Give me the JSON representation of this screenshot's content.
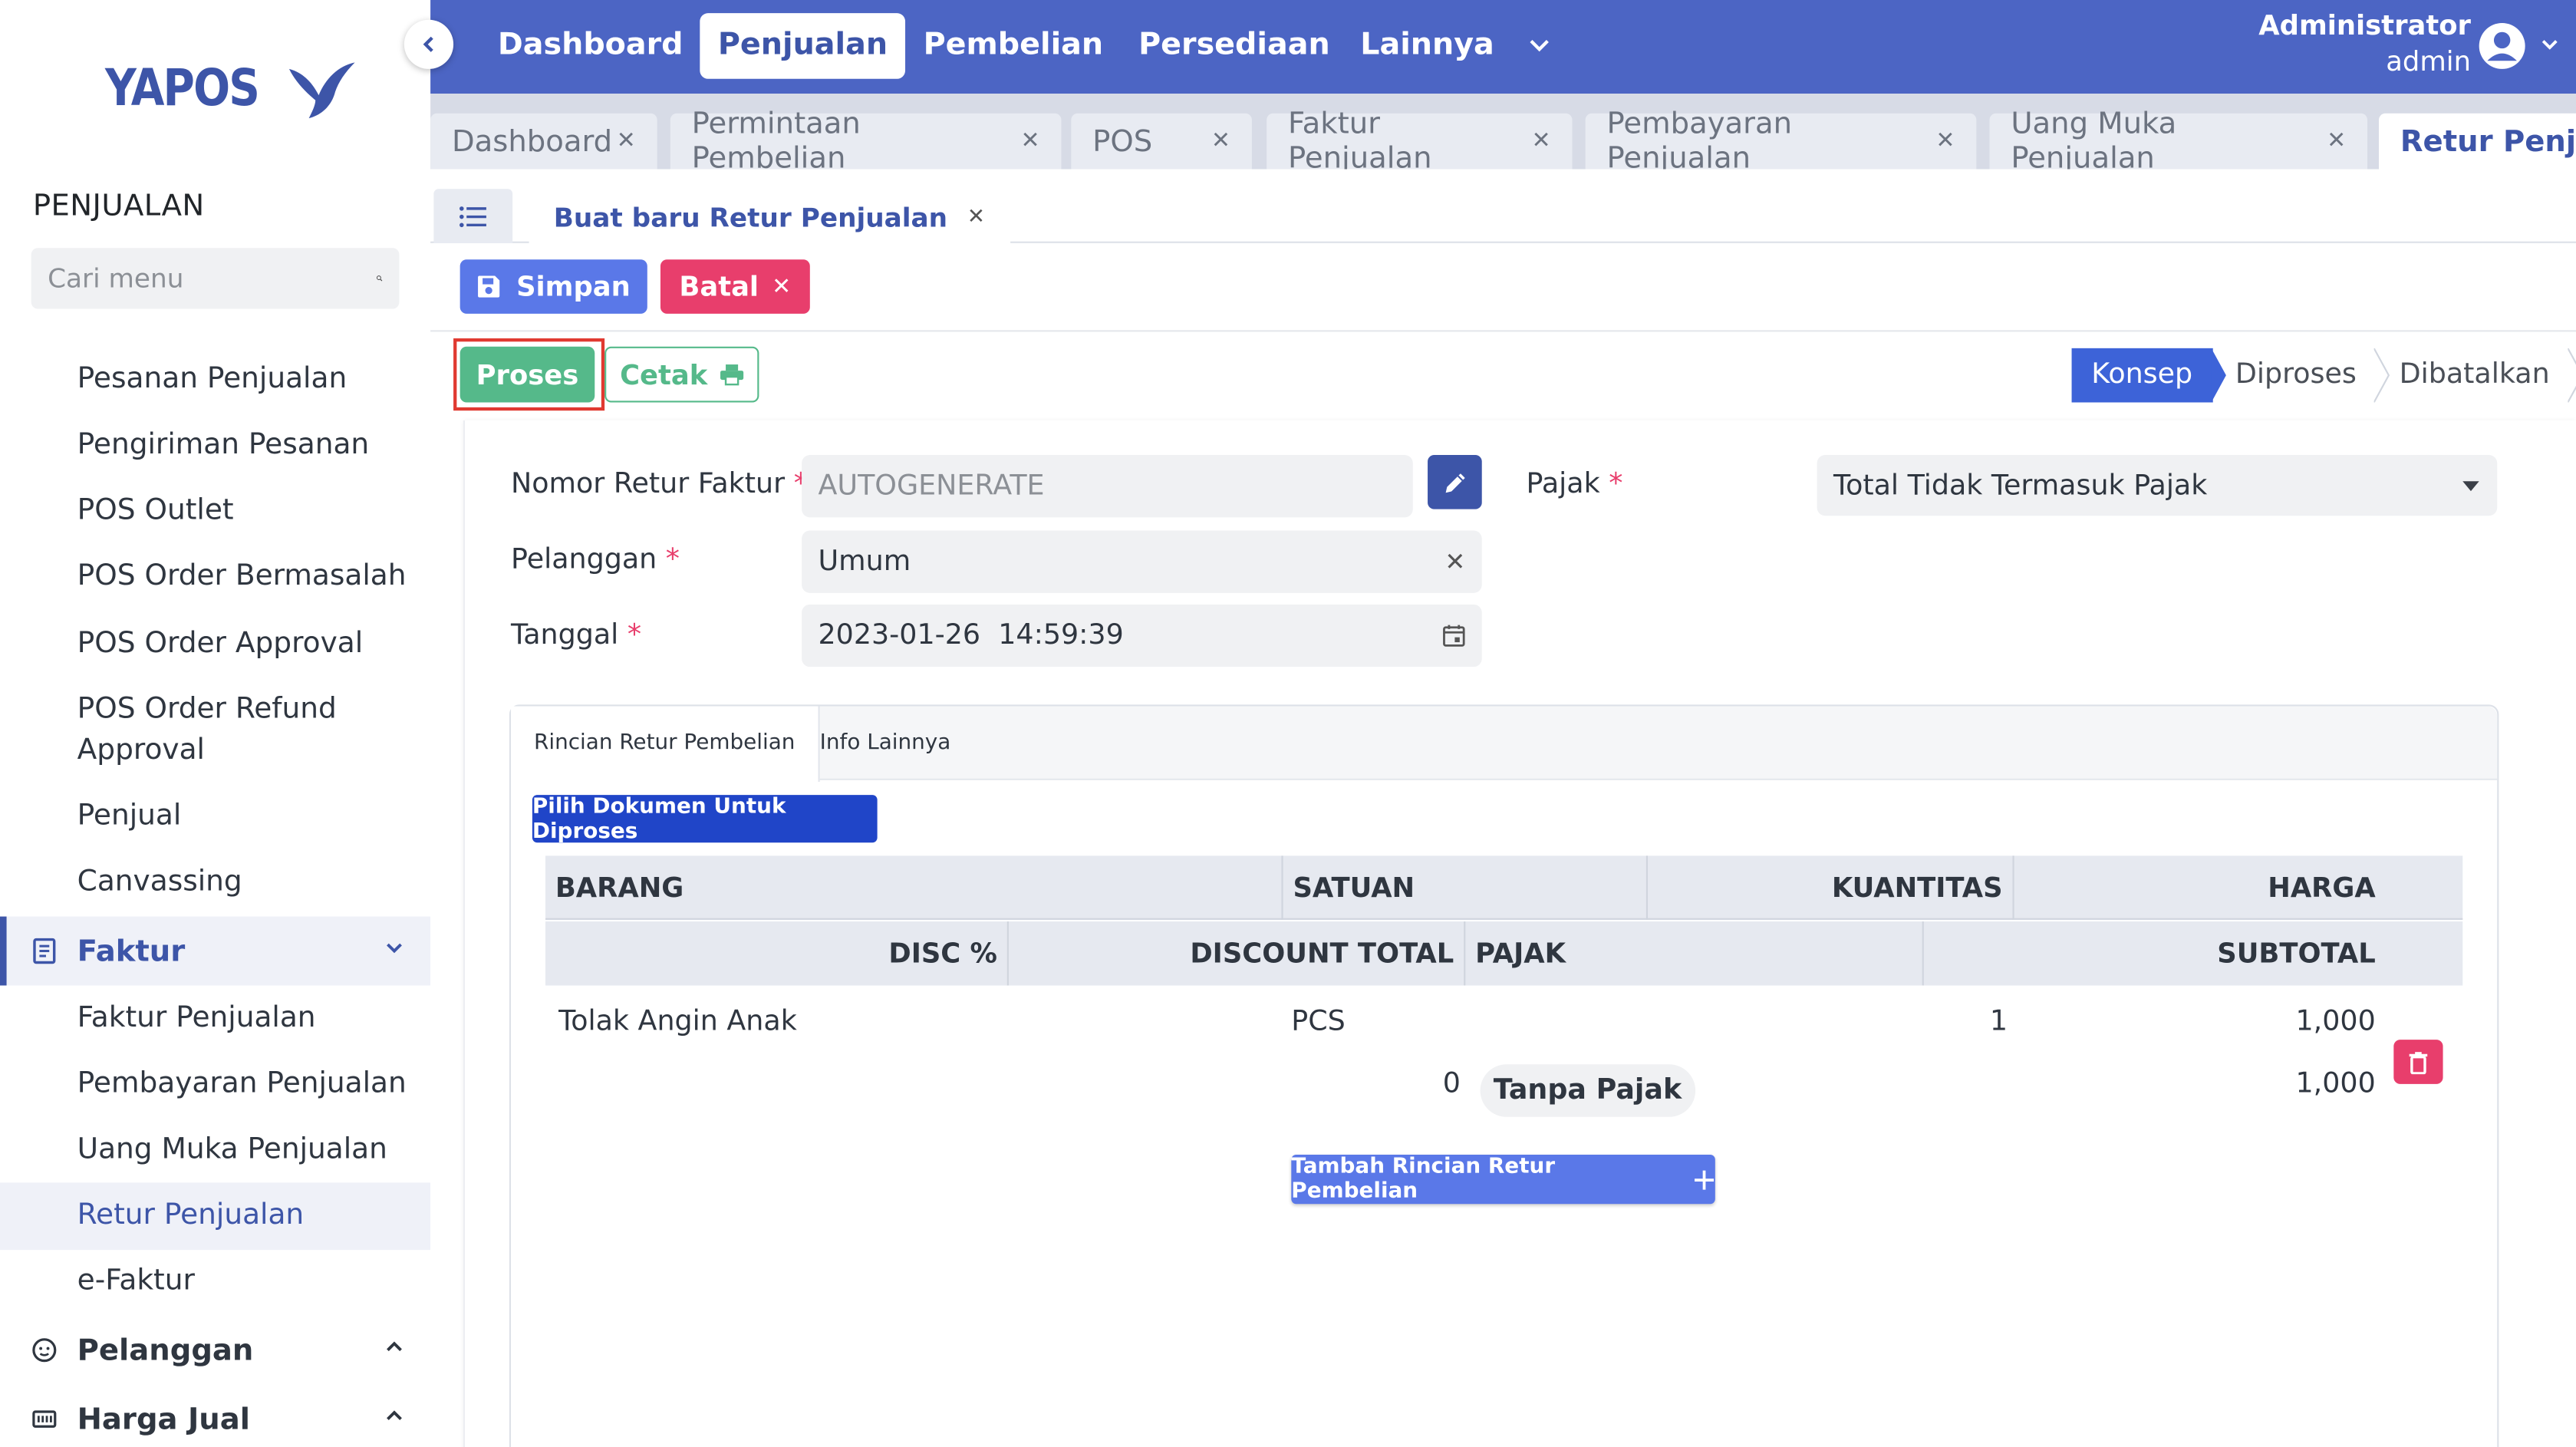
{
  "app": {
    "logo_text": "YAPOS"
  },
  "sidebar": {
    "section_title": "PENJUALAN",
    "search_placeholder": "Cari menu",
    "items": [
      "Pesanan Penjualan",
      "Pengiriman Pesanan",
      "POS Outlet",
      "POS Order Bermasalah",
      "POS Order Approval",
      "POS Order Refund",
      "Approval",
      "Penjual",
      "Canvassing"
    ],
    "group_faktur": "Faktur",
    "faktur_items": [
      "Faktur Penjualan",
      "Pembayaran Penjualan",
      "Uang Muka Penjualan",
      "Retur Penjualan",
      "e-Faktur"
    ],
    "group_pelanggan": "Pelanggan",
    "group_harga": "Harga Jual"
  },
  "topnav": {
    "items": [
      "Dashboard",
      "Penjualan",
      "Pembelian",
      "Persediaan",
      "Lainnya"
    ],
    "active": "Penjualan",
    "user_name": "Administrator",
    "user_role": "admin"
  },
  "tabs": [
    "Dashboard",
    "Permintaan Pembelian",
    "POS",
    "Faktur Penjualan",
    "Pembayaran Penjualan",
    "Uang Muka Penjualan",
    "Retur Penjualan"
  ],
  "doc_tab": "Buat baru Retur Penjualan",
  "toolbar": {
    "simpan": "Simpan",
    "batal": "Batal",
    "proses": "Proses",
    "cetak": "Cetak"
  },
  "status_steps": [
    "Konsep",
    "Diproses",
    "Dibatalkan"
  ],
  "form": {
    "nomor_label": "Nomor Retur Faktur",
    "nomor_value": "AUTOGENERATE",
    "pelanggan_label": "Pelanggan",
    "pelanggan_value": "Umum",
    "tanggal_label": "Tanggal",
    "tanggal_value": "2023-01-26  14:59:39",
    "pajak_label": "Pajak",
    "pajak_value": "Total Tidak Termasuk Pajak",
    "required_mark": "*"
  },
  "detail_tabs": [
    "Rincian Retur Pembelian",
    "Info Lainnya"
  ],
  "pilih_button": "Pilih Dokumen Untuk Diproses",
  "table": {
    "head1": [
      "BARANG",
      "SATUAN",
      "KUANTITAS",
      "HARGA"
    ],
    "head2": [
      "DISC %",
      "DISCOUNT TOTAL",
      "PAJAK",
      "SUBTOTAL"
    ],
    "row": {
      "barang": "Tolak Angin Anak",
      "satuan": "PCS",
      "kuantitas": "1",
      "harga": "1,000",
      "discount_total": "0",
      "pajak": "Tanpa Pajak",
      "subtotal": "1,000"
    }
  },
  "tambah_button": "Tambah Rincian Retur Pembelian",
  "colors": {
    "primary": "#4c65c4",
    "accent": "#5a78e8",
    "success": "#55b98a",
    "danger": "#e83e6c",
    "highlight": "#e03a31"
  }
}
